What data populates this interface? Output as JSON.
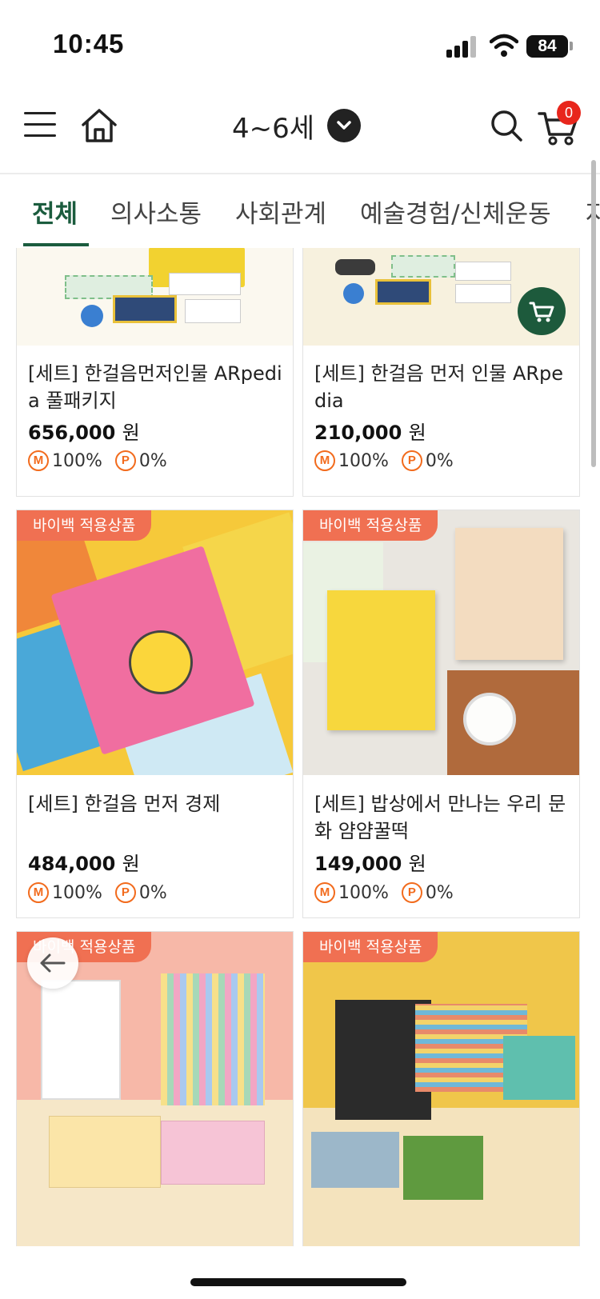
{
  "status_bar": {
    "time": "10:45",
    "battery": "84",
    "icons": [
      "signal-icon",
      "wifi-icon",
      "battery-icon"
    ]
  },
  "header": {
    "title": "4~6세",
    "cart_count": "0",
    "icons": [
      "menu-icon",
      "home-icon",
      "chevron-down-icon",
      "search-icon",
      "cart-icon"
    ]
  },
  "tabs": [
    {
      "label": "전체",
      "active": true
    },
    {
      "label": "의사소통"
    },
    {
      "label": "사회관계"
    },
    {
      "label": "예술경험/신체운동"
    },
    {
      "label": "자"
    }
  ],
  "colors": {
    "accent": "#1b5c3e",
    "badge": "#f07052",
    "rate": "#f26b1d",
    "cart_badge": "#e8261c"
  },
  "products": [
    {
      "name": "[세트] 한걸음먼저인물 ARpedia 풀패키지",
      "price": "656,000",
      "currency": "원",
      "m_rate": "100%",
      "p_rate": "0%",
      "m_icon": "M",
      "p_icon": "P"
    },
    {
      "name": "[세트] 한걸음 먼저 인물 ARpedia",
      "price": "210,000",
      "currency": "원",
      "m_rate": "100%",
      "p_rate": "0%",
      "m_icon": "M",
      "p_icon": "P"
    },
    {
      "name": "[세트] 한걸음 먼저 경제",
      "price": "484,000",
      "currency": "원",
      "m_rate": "100%",
      "p_rate": "0%",
      "m_icon": "M",
      "p_icon": "P",
      "badge": "바이백 적용상품"
    },
    {
      "name": "[세트] 밥상에서 만나는 우리 문화 얌얌꿀떡",
      "price": "149,000",
      "currency": "원",
      "m_rate": "100%",
      "p_rate": "0%",
      "m_icon": "M",
      "p_icon": "P",
      "badge": "바이백 적용상품"
    },
    {
      "badge": "바이백 적용상품"
    },
    {
      "badge": "바이백 적용상품"
    }
  ]
}
